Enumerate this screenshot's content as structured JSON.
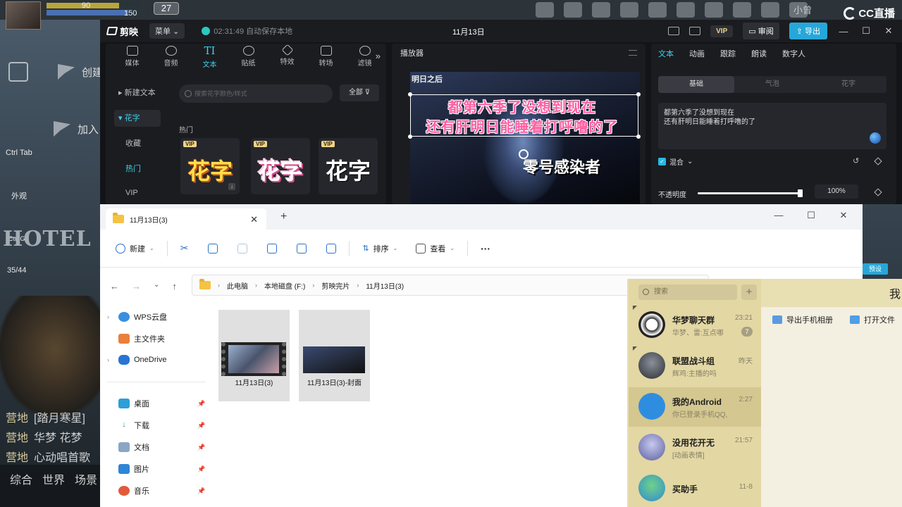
{
  "game": {
    "stat1": "90",
    "stat2": "150",
    "level": "27",
    "menu1": "创建",
    "menu2": "加入",
    "ctrl_tab": "Ctrl Tab",
    "appearance": "外观",
    "side3": "Ctrl G",
    "side4": "35/44",
    "hotel": "HOTEL",
    "chat": [
      {
        "tag": "营地",
        "text": "[踏月寒星]"
      },
      {
        "tag": "营地",
        "text": "华梦 花梦"
      },
      {
        "tag": "营地",
        "text": "心动唱首歌"
      }
    ],
    "tabs": [
      "综合",
      "世界",
      "场景"
    ],
    "top_right_text": "小曾",
    "cc_logo": "CC直播"
  },
  "jianying": {
    "app_name": "剪映",
    "menu_label": "菜单",
    "save_status": "02:31:49 自动保存本地",
    "date_title": "11月13日",
    "vip": "VIP",
    "review": "审阅",
    "export": "导出",
    "tools": [
      {
        "label": "媒体",
        "icon": "media-icon"
      },
      {
        "label": "音频",
        "icon": "audio-icon"
      },
      {
        "label": "文本",
        "icon": "text-icon"
      },
      {
        "label": "贴纸",
        "icon": "sticker-icon"
      },
      {
        "label": "特效",
        "icon": "effects-icon"
      },
      {
        "label": "转场",
        "icon": "transition-icon"
      },
      {
        "label": "滤镜",
        "icon": "filter-icon"
      }
    ],
    "text_tool_glyph": "TI",
    "categories": [
      "新建文本",
      "花字",
      "收藏",
      "热门",
      "VIP"
    ],
    "search_placeholder": "搜索花字颜色/样式",
    "filter_all": "全部",
    "section_hot": "热门",
    "huazi_vip": "VIP",
    "huazi_text": "花字",
    "player_title": "播放器",
    "player_logo": "明日之后",
    "subtitle_line1": "都第六季了没想到现在",
    "subtitle_line2": "还有肝明日能睡着打呼噜的了",
    "player_bottom": "零号感染者",
    "right_tabs": [
      "文本",
      "动画",
      "跟踪",
      "朗读",
      "数字人"
    ],
    "seg_tabs": [
      "基础",
      "气泡",
      "花字"
    ],
    "text_content_line1": "都第六季了没想到现在",
    "text_content_line2": "还有肝明日能睡着打呼噜的了",
    "mix_label": "混合",
    "opacity_label": "不透明度",
    "opacity_value": "100%",
    "opacity_fraction": 1.0
  },
  "explorer": {
    "tab_title": "11月13日(3)",
    "cmd": {
      "new": "新建",
      "sort": "排序",
      "view": "查看",
      "more": "···"
    },
    "path": [
      "此电脑",
      "本地磁盘 (F:)",
      "剪映完片",
      "11月13日(3)"
    ],
    "sidebar": [
      {
        "label": "WPS云盘",
        "icon": "cloud-icon"
      },
      {
        "label": "主文件夹",
        "icon": "home-icon"
      },
      {
        "label": "OneDrive",
        "icon": "onedrive-icon"
      },
      {
        "label": "桌面",
        "icon": "desktop-icon"
      },
      {
        "label": "下载",
        "icon": "download-icon"
      },
      {
        "label": "文档",
        "icon": "document-icon"
      },
      {
        "label": "图片",
        "icon": "pictures-icon"
      },
      {
        "label": "音乐",
        "icon": "music-icon"
      }
    ],
    "files": [
      {
        "name": "11月13日(3)"
      },
      {
        "name": "11月13日(3)-封面"
      }
    ]
  },
  "qq": {
    "search_placeholder": "搜索",
    "header_char": "我",
    "chats": [
      {
        "name": "华梦聊天群",
        "msg": "华梦、雷:互点哪",
        "time": "23:21",
        "badge": "7"
      },
      {
        "name": "联盟战斗组",
        "msg": "辉鸡:主播的吗",
        "time": "昨天",
        "badge": ""
      },
      {
        "name": "我的Android",
        "msg": "你已登录手机QQ,",
        "time": "2:27",
        "badge": ""
      },
      {
        "name": "没用花开无",
        "msg": "[动画表情]",
        "time": "21:57",
        "badge": ""
      },
      {
        "name": "买助手",
        "msg": "",
        "time": "11-8",
        "badge": ""
      }
    ],
    "btn_export_album": "导出手机相册",
    "btn_open_file": "打开文件"
  },
  "behind_button": "预设"
}
